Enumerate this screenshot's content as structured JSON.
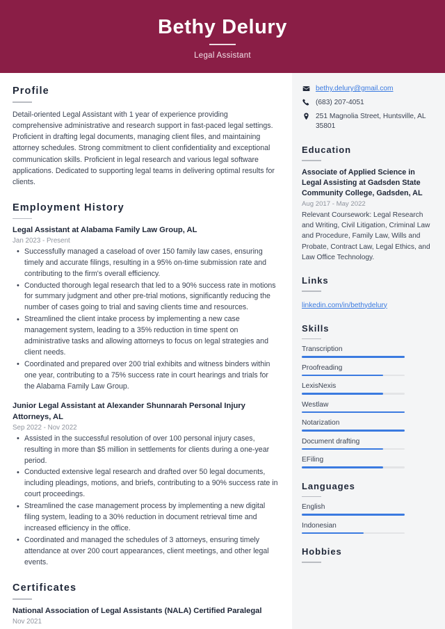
{
  "header": {
    "name": "Bethy Delury",
    "job_title": "Legal Assistant"
  },
  "main": {
    "profile": {
      "heading": "Profile",
      "text": "Detail-oriented Legal Assistant with 1 year of experience providing comprehensive administrative and research support in fast-paced legal settings. Proficient in drafting legal documents, managing client files, and maintaining attorney schedules. Strong commitment to client confidentiality and exceptional communication skills. Proficient in legal research and various legal software applications. Dedicated to supporting legal teams in delivering optimal results for clients."
    },
    "employment": {
      "heading": "Employment History",
      "jobs": [
        {
          "title": "Legal Assistant at Alabama Family Law Group, AL",
          "date": "Jan 2023 - Present",
          "bullets": [
            "Successfully managed a caseload of over 150 family law cases, ensuring timely and accurate filings, resulting in a 95% on-time submission rate and contributing to the firm's overall efficiency.",
            "Conducted thorough legal research that led to a 90% success rate in motions for summary judgment and other pre-trial motions, significantly reducing the number of cases going to trial and saving clients time and resources.",
            "Streamlined the client intake process by implementing a new case management system, leading to a 35% reduction in time spent on administrative tasks and allowing attorneys to focus on legal strategies and client needs.",
            "Coordinated and prepared over 200 trial exhibits and witness binders within one year, contributing to a 75% success rate in court hearings and trials for the Alabama Family Law Group."
          ]
        },
        {
          "title": "Junior Legal Assistant at Alexander Shunnarah Personal Injury Attorneys, AL",
          "date": "Sep 2022 - Nov 2022",
          "bullets": [
            "Assisted in the successful resolution of over 100 personal injury cases, resulting in more than $5 million in settlements for clients during a one-year period.",
            "Conducted extensive legal research and drafted over 50 legal documents, including pleadings, motions, and briefs, contributing to a 90% success rate in court proceedings.",
            "Streamlined the case management process by implementing a new digital filing system, leading to a 30% reduction in document retrieval time and increased efficiency in the office.",
            "Coordinated and managed the schedules of 3 attorneys, ensuring timely attendance at over 200 court appearances, client meetings, and other legal events."
          ]
        }
      ]
    },
    "certificates": {
      "heading": "Certificates",
      "items": [
        {
          "title": "National Association of Legal Assistants (NALA) Certified Paralegal",
          "date": "Nov 2021"
        }
      ]
    }
  },
  "sidebar": {
    "contacts": [
      {
        "icon": "envelope-icon",
        "text": "bethy.delury@gmail.com",
        "is_link": true
      },
      {
        "icon": "phone-icon",
        "text": "(683) 207-4051",
        "is_link": false
      },
      {
        "icon": "location-pin-icon",
        "text": "251 Magnolia Street, Huntsville, AL 35801",
        "is_link": false
      }
    ],
    "education": {
      "heading": "Education",
      "items": [
        {
          "title": "Associate of Applied Science in Legal Assisting at Gadsden State Community College, Gadsden, AL",
          "date": "Aug 2017 - May 2022",
          "description": "Relevant Coursework: Legal Research and Writing, Civil Litigation, Criminal Law and Procedure, Family Law, Wills and Probate, Contract Law, Legal Ethics, and Law Office Technology."
        }
      ]
    },
    "links": {
      "heading": "Links",
      "items": [
        {
          "label": "linkedin.com/in/bethydelury"
        }
      ]
    },
    "skills": {
      "heading": "Skills",
      "items": [
        {
          "label": "Transcription",
          "level": 100
        },
        {
          "label": "Proofreading",
          "level": 79
        },
        {
          "label": "LexisNexis",
          "level": 79
        },
        {
          "label": "Westlaw",
          "level": 100
        },
        {
          "label": "Notarization",
          "level": 100
        },
        {
          "label": "Document drafting",
          "level": 79
        },
        {
          "label": "EFiling",
          "level": 79
        }
      ]
    },
    "languages": {
      "heading": "Languages",
      "items": [
        {
          "label": "English",
          "level": 100
        },
        {
          "label": "Indonesian",
          "level": 60
        }
      ]
    },
    "hobbies": {
      "heading": "Hobbies"
    }
  },
  "colors": {
    "banner": "#8a1e46",
    "sidebar_bg": "#f4f5f6",
    "accent_blue": "#3a7ae0",
    "heading": "#1f2738",
    "muted": "#8f949e"
  }
}
